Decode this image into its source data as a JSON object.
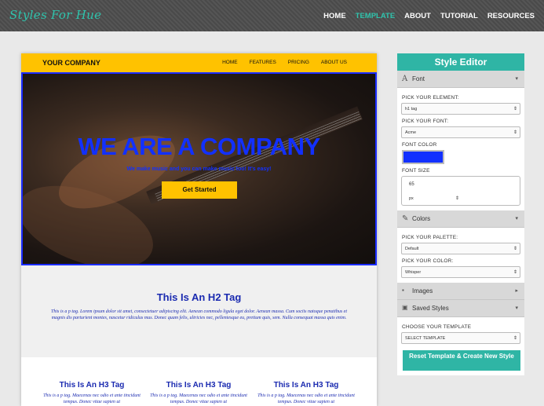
{
  "app": {
    "logo": "Styles For Hue",
    "nav": [
      "HOME",
      "TEMPLATE",
      "ABOUT",
      "TUTORIAL",
      "RESOURCES"
    ],
    "active_nav": "TEMPLATE",
    "accent_color": "#2fc4ad"
  },
  "preview": {
    "company": "YOUR COMPANY",
    "nav": [
      "HOME",
      "FEATURES",
      "PRICING",
      "ABOUT US"
    ],
    "hero_title": "WE ARE A COMPANY",
    "hero_subtitle": "We make music and you can make music too! It's easy!",
    "hero_button": "Get Started",
    "h2": "This Is An H2 Tag",
    "p": "This is a p tag. Lorem ipsum dolor sit amet, consectetuer adipiscing elit. Aenean commodo ligula eget dolor. Aenean massa. Cum sociis natoque penatibus et magnis dis parturient montes, nascetur ridiculus mus. Donec quam felis, ultricies nec, pellentesque eu, pretium quis, sem. Nulla consequat massa quis enim.",
    "columns": [
      {
        "h3": "This Is An H3 Tag",
        "p": "This is a p tag. Maecenas nec odio et ante tincidunt tempus. Donec vitae sapien ut"
      },
      {
        "h3": "This Is An H3 Tag",
        "p": "This is a p tag. Maecenas nec odio et ante tincidunt tempus. Donec vitae sapien ut"
      },
      {
        "h3": "This Is An H3 Tag",
        "p": "This is a p tag. Maecenas nec odio et ante tincidunt tempus. Donec vitae sapien ut"
      }
    ],
    "header_color": "#ffc200",
    "text_color": "#1230ff"
  },
  "editor": {
    "title": "Style Editor",
    "font_section": {
      "label": "Font",
      "pick_element_label": "PICK YOUR ELEMENT:",
      "element_value": "h1 tag",
      "pick_font_label": "PICK YOUR FONT:",
      "font_value": "Acme",
      "font_color_label": "FONT COLOR",
      "font_color": "#1230ff",
      "font_size_label": "FONT SIZE",
      "font_size_value": "65",
      "font_size_unit": "px"
    },
    "colors_section": {
      "label": "Colors",
      "palette_label": "PICK YOUR PALETTE:",
      "palette_value": "Default",
      "color_label": "PICK YOUR COLOR:",
      "color_value": "Whisper"
    },
    "images_section": {
      "label": "Images"
    },
    "saved_section": {
      "label": "Saved Styles",
      "template_label": "CHOOSE YOUR TEMPLATE",
      "template_value": "SELECT TEMPLATE",
      "reset_button": "Reset Template & Create New Style"
    },
    "panel_color": "#2fb5a5"
  }
}
